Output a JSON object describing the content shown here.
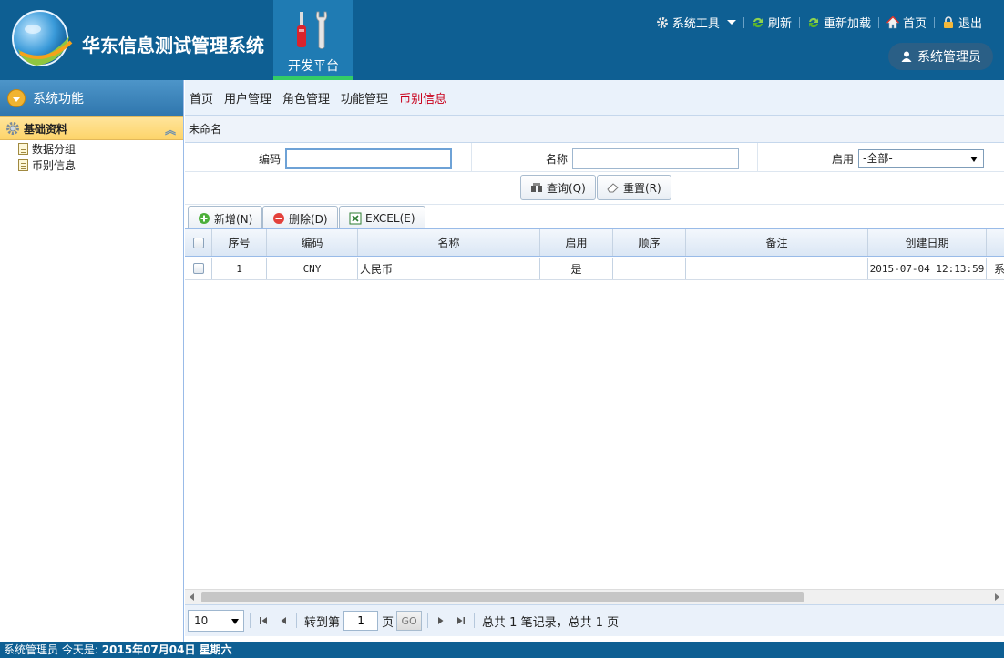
{
  "app": {
    "title": "华东信息测试管理系统"
  },
  "platform_tab": {
    "label": "开发平台"
  },
  "top_menu": {
    "tools": "系统工具",
    "refresh": "刷新",
    "reload": "重新加载",
    "home": "首页",
    "logout": "退出"
  },
  "user": {
    "name": "系统管理员"
  },
  "sidebar": {
    "header": "系统功能",
    "group": "基础资料",
    "items": [
      {
        "label": "数据分组"
      },
      {
        "label": "币别信息"
      }
    ]
  },
  "tabs": [
    {
      "label": "首页"
    },
    {
      "label": "用户管理"
    },
    {
      "label": "角色管理"
    },
    {
      "label": "功能管理"
    },
    {
      "label": "币别信息",
      "active": true
    }
  ],
  "panel": {
    "title": "未命名"
  },
  "search": {
    "code_label": "编码",
    "code_value": "",
    "name_label": "名称",
    "name_value": "",
    "enabled_label": "启用",
    "enabled_value": "-全部-"
  },
  "buttons": {
    "query": "查询(Q)",
    "reset": "重置(R)",
    "add": "新增(N)",
    "delete": "删除(D)",
    "excel": "EXCEL(E)"
  },
  "grid": {
    "columns": [
      "序号",
      "编码",
      "名称",
      "启用",
      "顺序",
      "备注",
      "创建日期"
    ],
    "rows": [
      {
        "index": "1",
        "code": "CNY",
        "name": "人民币",
        "enabled": "是",
        "order": "",
        "remark": "",
        "created": "2015-07-04 12:13:59",
        "extra": "系"
      }
    ]
  },
  "pager": {
    "page_size": "10",
    "goto_label": "转到第",
    "page_value": "1",
    "page_unit": "页",
    "go": "GO",
    "summary": "总共 1 笔记录，总共 1 页"
  },
  "status": {
    "prefix": "系统管理员 今天是:",
    "date": "2015年07月04日 星期六"
  },
  "colors": {
    "header_bg": "#0e5f93",
    "active_tab": "#c9001b",
    "accent": "#33cc66"
  }
}
